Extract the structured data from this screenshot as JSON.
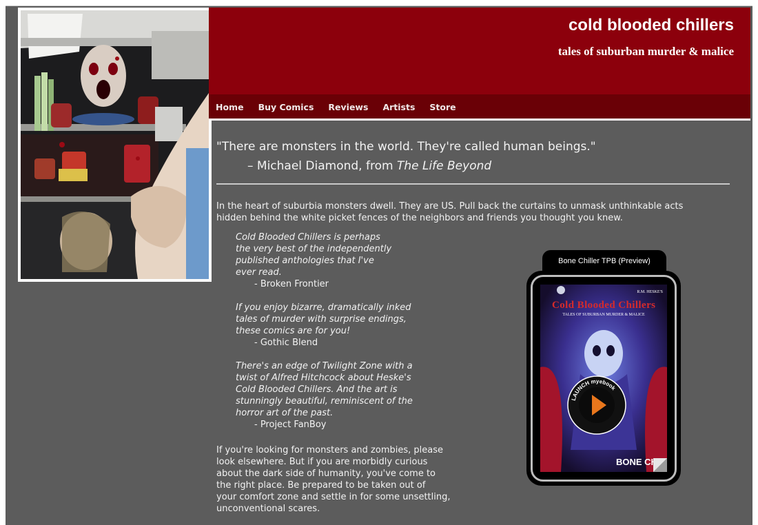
{
  "site": {
    "title": "cold blooded chillers",
    "tagline": "tales of suburban murder & malice"
  },
  "nav": {
    "items": [
      "Home",
      "Buy Comics",
      "Reviews",
      "Artists",
      "Store"
    ]
  },
  "quote": {
    "text": "\"There are monsters in the world. They're called human beings.\"",
    "attribution_prefix": "– Michael Diamond, from ",
    "attribution_work": "The Life Beyond"
  },
  "intro": "In the heart of suburbia monsters dwell. They are US. Pull back the curtains to unmask unthinkable acts hidden behind the white picket fences of the neighbors and friends you thought you knew.",
  "reviews": [
    {
      "lines": [
        "Cold Blooded Chillers is perhaps",
        "the very best of the independently",
        "published anthologies that I've",
        "ever read."
      ],
      "source": "- Broken Frontier"
    },
    {
      "lines": [
        "If you enjoy bizarre, dramatically inked",
        "tales of murder with surprise endings,",
        "these comics are for you!"
      ],
      "source": "- Gothic Blend"
    },
    {
      "lines": [
        "There's an edge of Twilight Zone with a",
        "twist of Alfred Hitchcock about Heske's",
        "Cold Blooded Chillers. And the art is",
        "stunningly beautiful, reminiscent of the",
        "horror art of the past."
      ],
      "source": "- Project FanBoy"
    }
  ],
  "closing_lines": [
    "If you're looking for monsters and zombies, please",
    "look elsewhere. But if you are morbidly curious",
    "about the dark side of humanity, you've come to",
    "the right place. Be prepared to be taken out of",
    "your comfort zone and settle in for some unsettling,",
    "unconventional scares."
  ],
  "ebook": {
    "tab_label": "Bone Chiller TPB (Preview)",
    "cover_author": "R.M. HESKE'S",
    "cover_title": "Cold Blooded Chillers",
    "cover_subtitle": "TALES OF SUBURBAN MURDER & MALICE",
    "launch_text": "LAUNCH myebook",
    "cover_footer": "BONE CHIL"
  },
  "colors": {
    "header_red": "#8c000c",
    "nav_red": "#6a0006",
    "page_gray": "#5c5c5c",
    "launch_orange": "#e8761c"
  }
}
